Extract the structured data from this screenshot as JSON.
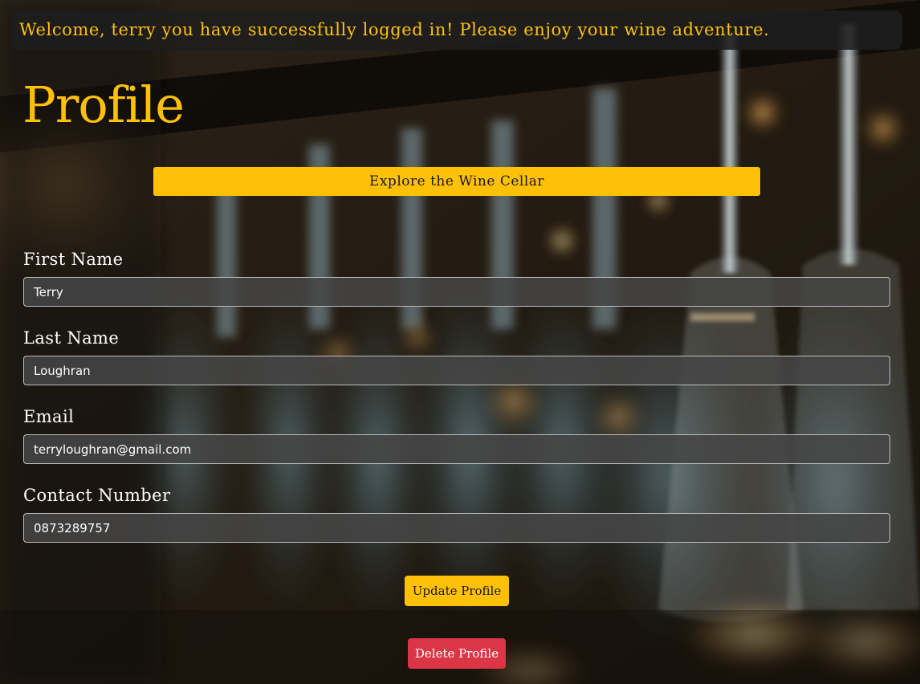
{
  "banner": {
    "message": "Welcome, terry you have successfully logged in! Please enjoy your wine adventure."
  },
  "page": {
    "title": "Profile"
  },
  "actions": {
    "explore_label": "Explore the Wine Cellar",
    "update_label": "Update Profile",
    "delete_label": "Delete Profile"
  },
  "form": {
    "first_name": {
      "label": "First Name",
      "value": "Terry"
    },
    "last_name": {
      "label": "Last Name",
      "value": "Loughran"
    },
    "email": {
      "label": "Email",
      "value": "terryloughran@gmail.com"
    },
    "contact_number": {
      "label": "Contact Number",
      "value": "0873289757"
    }
  },
  "colors": {
    "accent": "#ffc107",
    "danger": "#dc3545",
    "banner_bg": "#1e1e1e",
    "input_bg": "#464646"
  },
  "background": {
    "description_icon": "wine-glasses-bar-background"
  }
}
